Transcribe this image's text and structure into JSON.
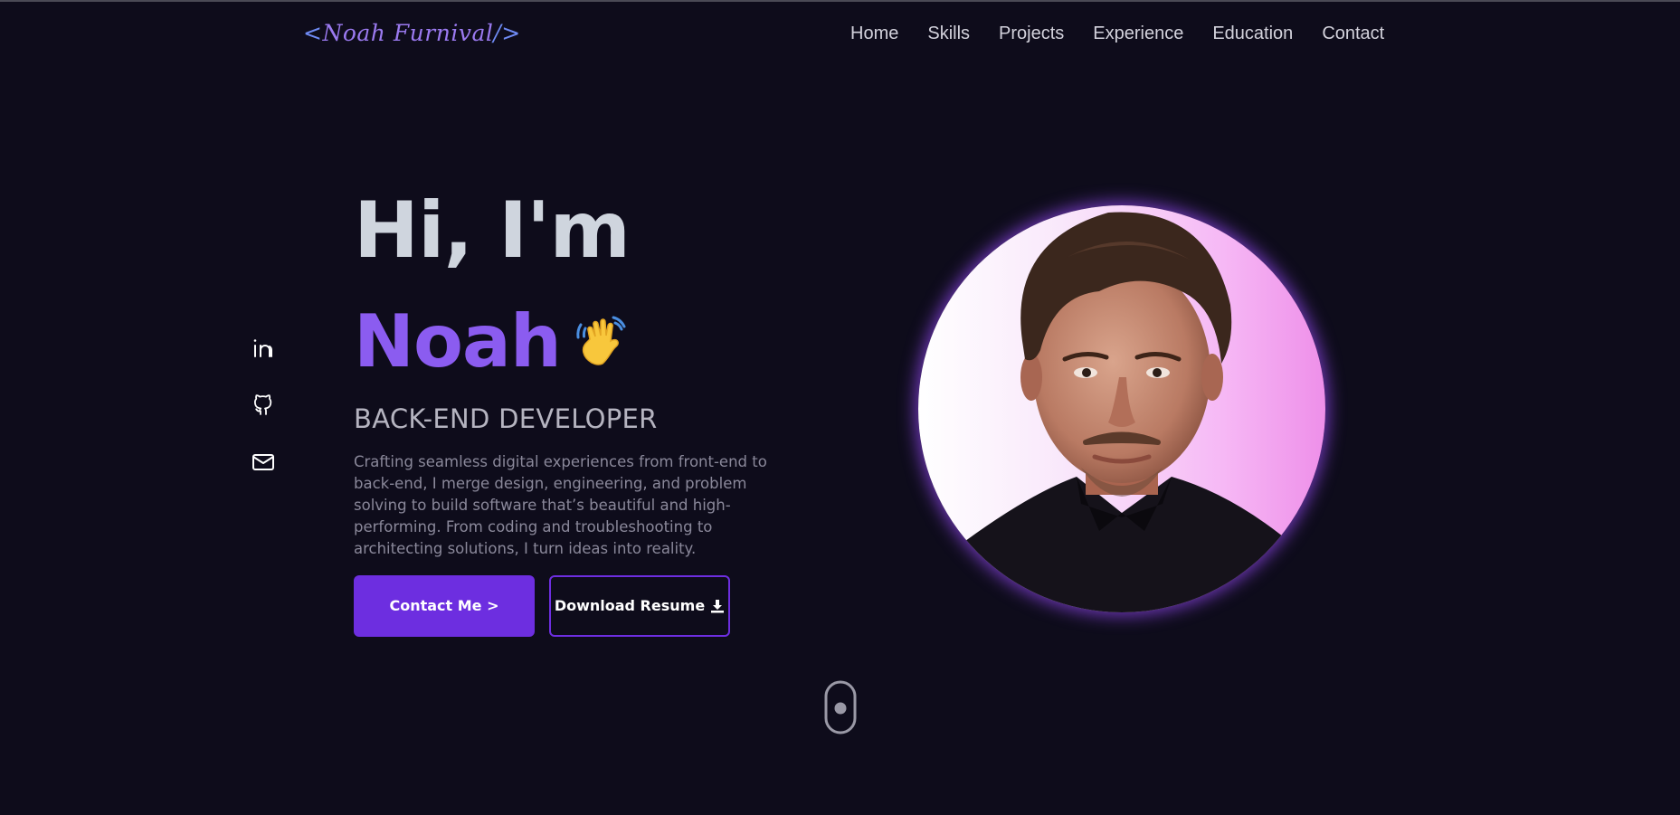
{
  "brand": {
    "logo_open": "<",
    "logo_name": "Noah Furnival",
    "logo_close": "/>",
    "accent": "#8b5cf0",
    "accent_dark": "#6d2ee0",
    "background": "#0e0c1b"
  },
  "nav": {
    "items": [
      {
        "label": "Home"
      },
      {
        "label": "Skills"
      },
      {
        "label": "Projects"
      },
      {
        "label": "Experience"
      },
      {
        "label": "Education"
      },
      {
        "label": "Contact"
      }
    ]
  },
  "social": {
    "icons": [
      "linkedin-icon",
      "github-icon",
      "mail-icon"
    ]
  },
  "hero": {
    "greeting": "Hi, I'm",
    "name": "Noah",
    "wave_icon": "waving-hand-icon",
    "role": "BACK-END DEVELOPER",
    "description": "Crafting seamless digital experiences from front-end to back-end, I merge design, engineering, and problem solving to build software that’s beautiful and high-performing. From coding and troubleshooting to architecting solutions, I turn ideas into reality.",
    "contact_button": "Contact Me >",
    "resume_button": "Download Resume",
    "resume_icon": "download-icon"
  },
  "portrait": {
    "icon": "profile-photo",
    "glow_color": "#8c46e6"
  },
  "scroll_indicator": {
    "icon": "mouse-scroll-icon"
  }
}
